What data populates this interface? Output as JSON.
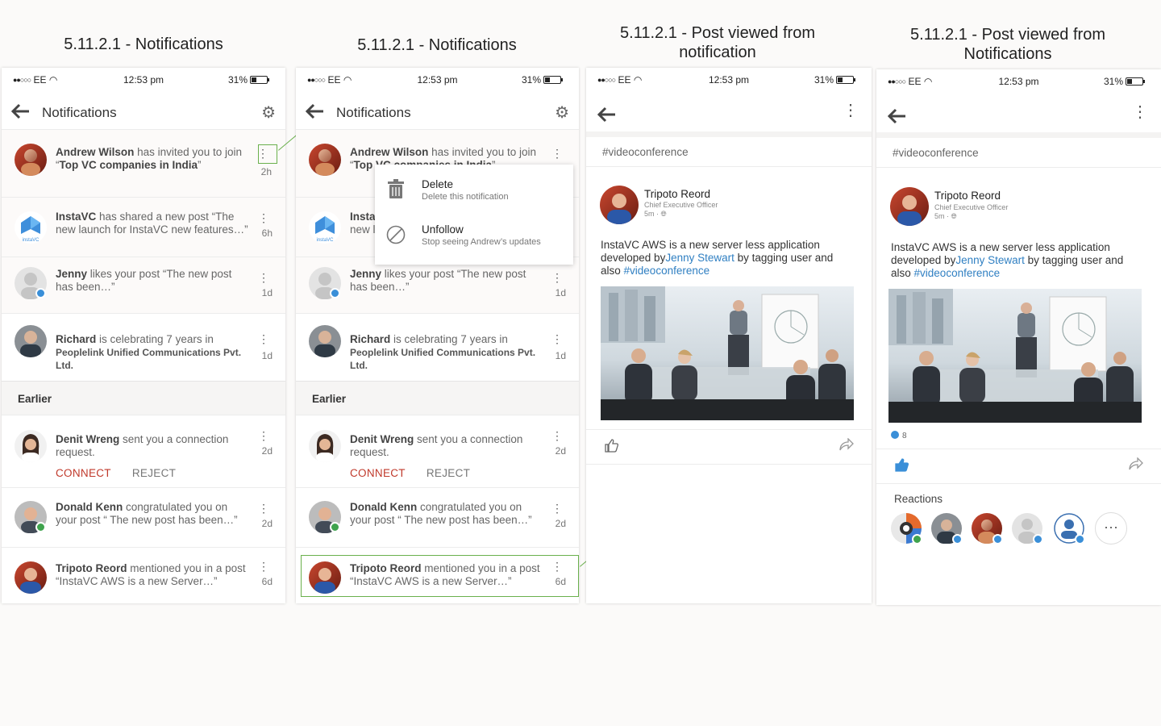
{
  "captions": {
    "c1": "5.11.2.1 - Notifications",
    "c2": "5.11.2.1 - Notifications",
    "c3_line1": "5.11.2.1 - Post viewed from",
    "c3_line2": "notification",
    "c4_line1": "5.11.2.1 - Post viewed from",
    "c4_line2": "Notifications"
  },
  "status": {
    "carrier": "EE",
    "time": "12:53 pm",
    "battery": "31%"
  },
  "notifications": {
    "title": "Notifications",
    "earlier_label": "Earlier",
    "recent": [
      {
        "name": "Andrew Wilson",
        "pre": " has invited you to join “",
        "bold2": "Top VC companies in India",
        "post": "”",
        "age": "2h"
      },
      {
        "name": "InstaVC",
        "pre": " has shared a new post “The new launch for InstaVC new features…”",
        "age": "6h"
      },
      {
        "name": "Jenny",
        "pre": " likes your post “The new post has been…”",
        "age": "1d"
      },
      {
        "name": "Richard",
        "pre": " is celebrating 7 years in",
        "sub": "Peoplelink Unified Communications Pvt. Ltd.",
        "age": "1d"
      }
    ],
    "older": [
      {
        "name": "Denit Wreng",
        "pre": " sent you a connection request.",
        "age": "2d",
        "connect": "CONNECT",
        "reject": "REJECT"
      },
      {
        "name": "Donald Kenn",
        "pre": " congratulated you on your post “ The new post has been…”",
        "age": "2d"
      },
      {
        "name": "Tripoto Reord",
        "pre": " mentioned you in a post “InstaVC AWS is a new Server…”",
        "age": "6d"
      }
    ],
    "instavc_logo_text": "instaVC"
  },
  "menu": {
    "delete_title": "Delete",
    "delete_sub": "Delete this notification",
    "unfollow_title": "Unfollow",
    "unfollow_sub": "Stop seeing Andrew’s updates"
  },
  "post": {
    "hashtag_header": "#videoconference",
    "author": "Tripoto Reord",
    "role": "Chief Executive Officer",
    "time": "5m",
    "text_1": "InstaVC AWS is a new server less application developed by",
    "mention": "Jenny Stewart",
    "text_2": " by tagging user and also ",
    "hashtag": "#videoconference",
    "reaction_count": "8",
    "reactions_label": "Reactions",
    "more_reactions": "···"
  },
  "colors": {
    "accent_green": "#6ab04c",
    "link_blue": "#2f7fc2",
    "connect_red": "#c0392b",
    "like_blue": "#3a8fd8"
  }
}
